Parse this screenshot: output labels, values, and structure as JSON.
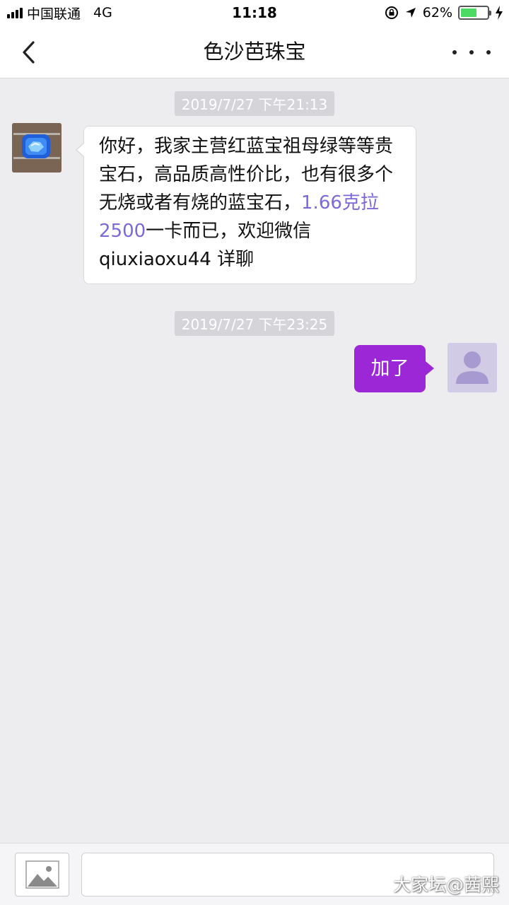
{
  "status_bar": {
    "carrier": "中国联通",
    "network": "4G",
    "time": "11:18",
    "battery_percent_label": "62%",
    "battery_level": 0.62,
    "icons": [
      "signal-icon",
      "orientation-lock-icon",
      "location-arrow-icon",
      "battery-icon",
      "charging-bolt-icon"
    ]
  },
  "nav": {
    "back_icon": "chevron-left-icon",
    "title": "色沙芭珠宝",
    "more_icon": "more-dots-icon"
  },
  "messages": [
    {
      "timestamp": "2019/7/27 下午21:13",
      "sender": "other",
      "avatar": "sapphire-avatar",
      "text_before": "你好，我家主营红蓝宝祖母绿等等贵宝石，高品质高性价比，也有很多个无烧或者有烧的蓝宝石，",
      "text_highlight": "1.66克拉2500",
      "text_after": "一卡而已，欢迎微信qiuxiaoxu44 详聊"
    },
    {
      "timestamp": "2019/7/27 下午23:25",
      "sender": "me",
      "avatar": "default-user-avatar",
      "text": "加了"
    }
  ],
  "input_bar": {
    "image_icon": "image-picker-icon",
    "placeholder": ""
  },
  "watermark": "大家坛@茜熙",
  "colors": {
    "my_bubble": "#9c27d6",
    "link_text": "#7a6ad8",
    "background": "#ededf0"
  }
}
